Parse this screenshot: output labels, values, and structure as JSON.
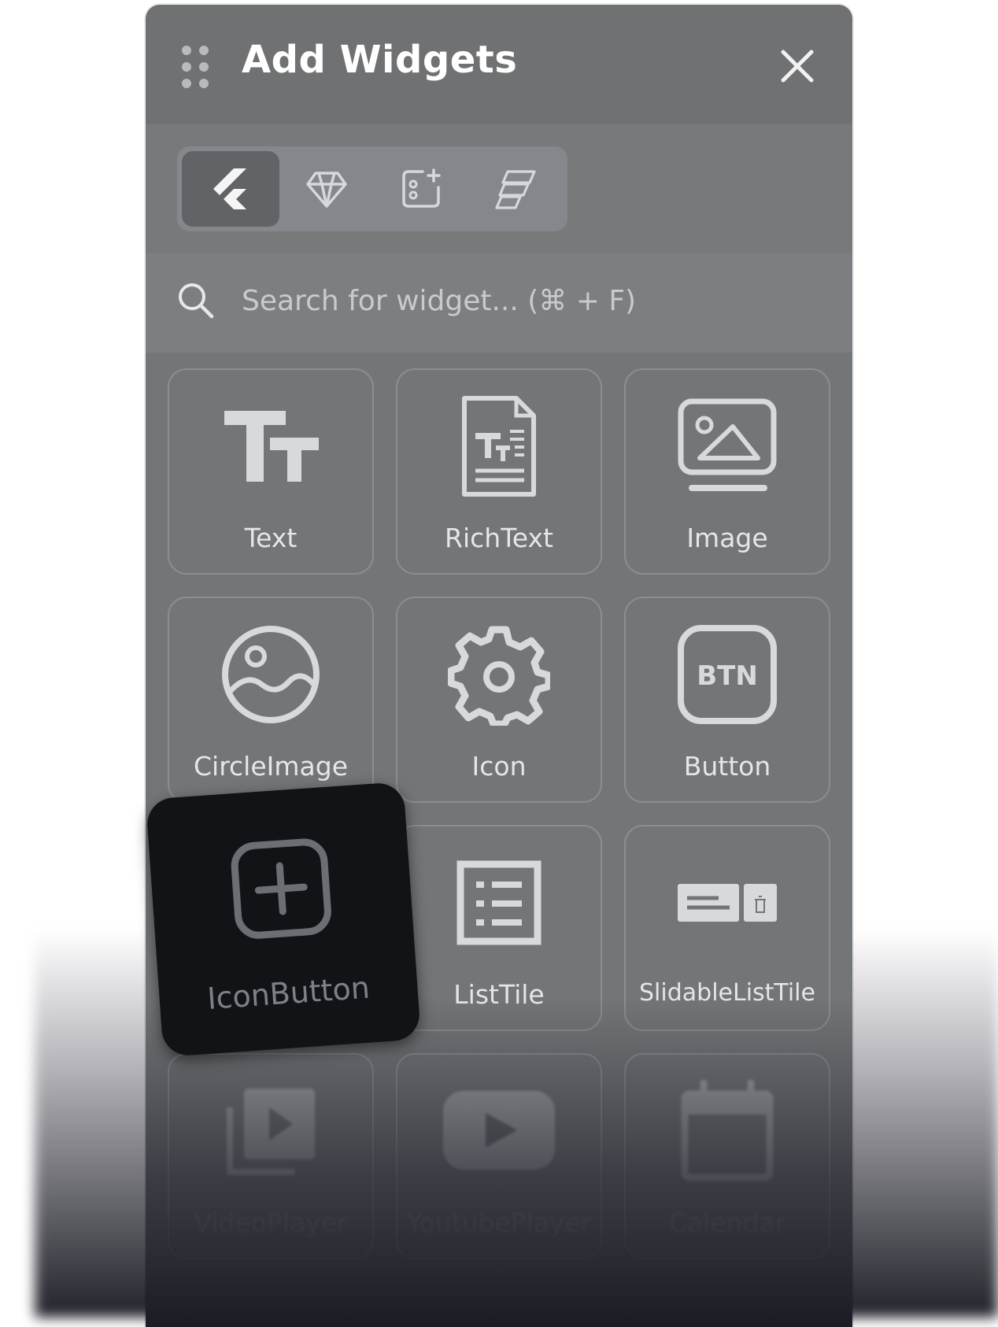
{
  "panel": {
    "title": "Add Widgets",
    "close_icon": "close-icon",
    "drag_icon": "drag-handle-icon"
  },
  "tabs": [
    {
      "icon": "flutter-icon",
      "active": true
    },
    {
      "icon": "diamond-icon",
      "active": false
    },
    {
      "icon": "custom-widget-icon",
      "active": false
    },
    {
      "icon": "layout-icon",
      "active": false
    }
  ],
  "search": {
    "placeholder": "Search for widget... (⌘ + F)"
  },
  "widgets": [
    {
      "label": "Text",
      "icon": "text-icon"
    },
    {
      "label": "RichText",
      "icon": "rich-text-icon"
    },
    {
      "label": "Image",
      "icon": "image-icon"
    },
    {
      "label": "CircleImage",
      "icon": "circle-image-icon"
    },
    {
      "label": "Icon",
      "icon": "gear-icon"
    },
    {
      "label": "Button",
      "icon": "button-icon",
      "icon_text": "BTN"
    },
    {
      "label": "IconButton",
      "icon": "add-box-icon",
      "dragging": true
    },
    {
      "label": "ListTile",
      "icon": "list-icon"
    },
    {
      "label": "SlidableListTile",
      "icon": "slidable-list-icon"
    },
    {
      "label": "VideoPlayer",
      "icon": "video-library-icon"
    },
    {
      "label": "YoutubePlayer",
      "icon": "youtube-icon"
    },
    {
      "label": "Calendar",
      "icon": "calendar-icon"
    }
  ],
  "colors": {
    "panel_bg": "#737678",
    "tile_border": "#8b8e91",
    "drag_tile_bg": "#121316"
  }
}
